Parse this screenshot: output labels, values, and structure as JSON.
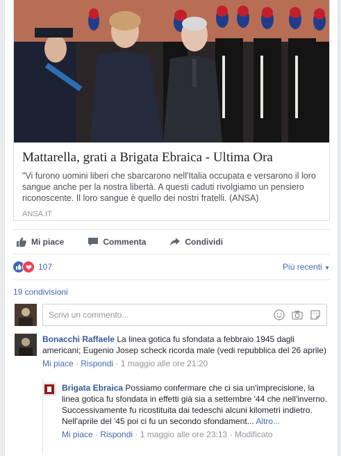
{
  "link_preview": {
    "title": "Mattarella, grati a Brigata Ebraica - Ultima Ora",
    "description": "\"Vi furono uomini liberi che sbarcarono nell'Italia occupata e versarono il loro sangue anche per la nostra libertà. A questi caduti rivolgiamo un pensiero riconoscente. Il loro sangue è quello dei nostri fratelli. (ANSA)",
    "source": "ANSA.IT"
  },
  "actions": {
    "like": "Mi piace",
    "comment": "Commenta",
    "share": "Condividi"
  },
  "reactions": {
    "count": "107",
    "sort": "Più recenti"
  },
  "shares": "19 condivisioni",
  "comment_input": {
    "placeholder": "Scrivi un commento..."
  },
  "comments": [
    {
      "author": "Bonacchi Raffaele",
      "text": "La linea gotica fu sfondata a febbraio 1945 dagli americani; Eugenio Josep scheck ricorda male (vedi repubblica del 26 aprile)",
      "like": "Mi piace",
      "reply": "Rispondi",
      "time": "1 maggio alle ore 21:20"
    }
  ],
  "reply": {
    "author": "Brigata Ebraica",
    "text": "Possiamo confermare che ci sia un'imprecisione, la linea gotica fu sfondata in effetti già sia a settembre '44 che nell'inverno. Successivamente fu ricostituita dai tedeschi alcuni kilometri indietro. Nell'aprile del '45 poi ci fu un secondo sfondament...",
    "more": "Altro...",
    "like": "Mi piace",
    "reply": "Rispondi",
    "time": "1 maggio alle ore 23:13",
    "edited": "Modificato"
  },
  "colors": {
    "link": "#4267b2",
    "name": "#365899",
    "muted": "#90949c",
    "love": "#f33e58"
  }
}
